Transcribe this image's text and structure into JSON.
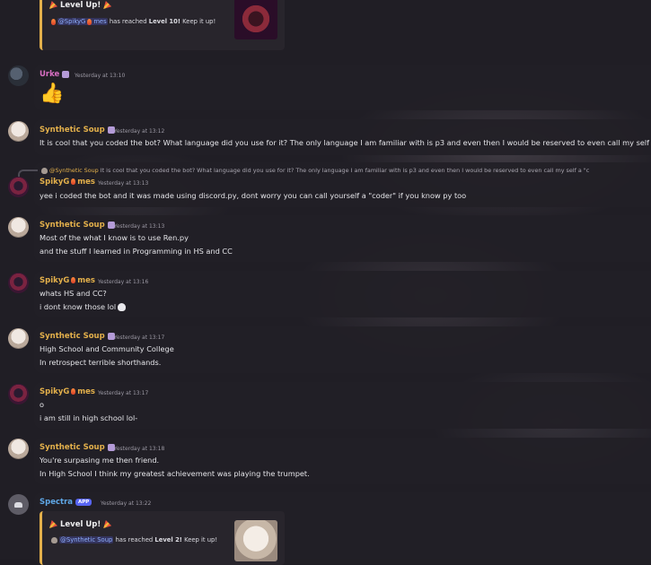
{
  "messages": [
    {
      "embed_top": {
        "title": "Level Up!",
        "mention": "@SpikyG",
        "mention_suffix": "mes",
        "desc_pre": "has reached",
        "level": "Level 10!",
        "desc_post": "Keep it up!"
      }
    },
    {
      "author": "Urke",
      "time": "Yesterday at 13:10",
      "content": "👍"
    },
    {
      "author": "Synthetic Soup",
      "time": "Yesterday at 13:12",
      "lines": [
        "It is cool that you coded the bot? What language did you use for it? The only language I am familiar with is p3 and even then I would be reserved to even call my self a"
      ]
    },
    {
      "reply_author": "@Synthetic Soup",
      "reply_text": "It is cool that you coded the bot? What language did you use for it? The only language I am familiar with is p3 and even then I would be reserved to even call my self a \"c",
      "author": "SpikyG",
      "author_suffix": "mes",
      "time": "Yesterday at 13:13",
      "lines": [
        "yee i coded the bot and it was made using discord.py, dont worry you can call yourself a \"coder\" if you know py too"
      ]
    },
    {
      "author": "Synthetic Soup",
      "time": "Yesterday at 13:13",
      "lines": [
        "Most of the what I know is to use Ren.py",
        "and the stuff I learned in Programming in HS and CC"
      ]
    },
    {
      "author": "SpikyG",
      "author_suffix": "mes",
      "time": "Yesterday at 13:16",
      "lines": [
        "whats HS and CC?",
        "i dont know those lol"
      ]
    },
    {
      "author": "Synthetic Soup",
      "time": "Yesterday at 13:17",
      "lines": [
        "High School and Community College",
        "In retrospect terrible shorthands."
      ]
    },
    {
      "author": "SpikyG",
      "author_suffix": "mes",
      "time": "Yesterday at 13:17",
      "lines": [
        "o",
        "i am still in high school lol-"
      ]
    },
    {
      "author": "Synthetic Soup",
      "time": "Yesterday at 13:18",
      "lines": [
        "You're surpasing me then friend.",
        "In High School I think my greatest achievement was playing the trumpet."
      ]
    },
    {
      "author": "Spectra",
      "author_tag": "APP",
      "time": "Yesterday at 13:22",
      "embed": {
        "title": "Level Up!",
        "mention": "@Synthetic Soup",
        "desc_pre": "has reached",
        "level": "Level 2!",
        "desc_post": "Keep it up!"
      }
    }
  ]
}
